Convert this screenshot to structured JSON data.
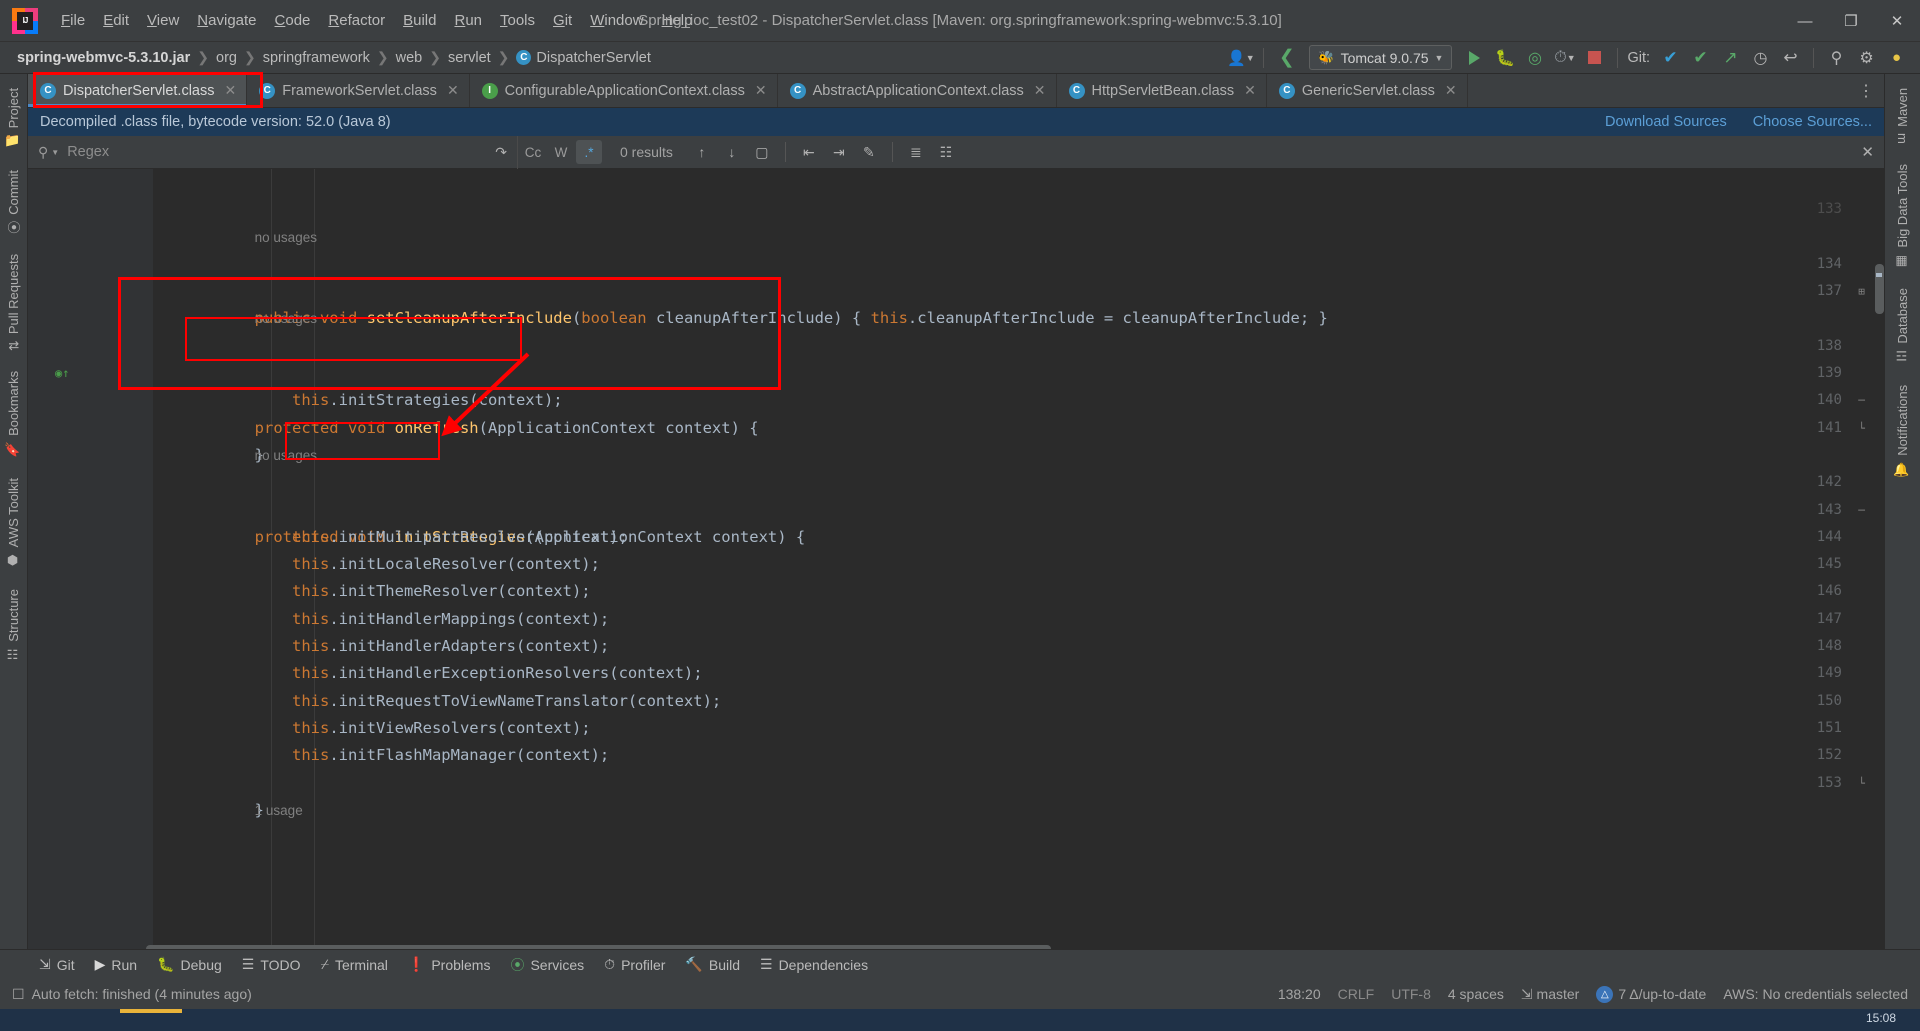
{
  "window": {
    "title": "Spring_ioc_test02 - DispatcherServlet.class [Maven: org.springframework:spring-webmvc:5.3.10]",
    "minimize": "—",
    "maximize": "❐",
    "close": "✕"
  },
  "menu": [
    {
      "label": "File"
    },
    {
      "label": "Edit"
    },
    {
      "label": "View"
    },
    {
      "label": "Navigate"
    },
    {
      "label": "Code"
    },
    {
      "label": "Refactor"
    },
    {
      "label": "Build"
    },
    {
      "label": "Run"
    },
    {
      "label": "Tools"
    },
    {
      "label": "Git"
    },
    {
      "label": "Window"
    },
    {
      "label": "Help"
    }
  ],
  "breadcrumb": [
    {
      "label": "spring-webmvc-5.3.10.jar",
      "icon": "none"
    },
    {
      "label": "org",
      "icon": "none"
    },
    {
      "label": "springframework",
      "icon": "none"
    },
    {
      "label": "web",
      "icon": "none"
    },
    {
      "label": "servlet",
      "icon": "none"
    },
    {
      "label": "DispatcherServlet",
      "icon": "class"
    }
  ],
  "toolbar": {
    "run_config": "Tomcat 9.0.75",
    "git_label": "Git:",
    "icons": {
      "user": "👤",
      "back_arrow": "‹",
      "run": "run-triangle",
      "debug": "🐞",
      "run_with_coverage": "coverage",
      "profiler": "profiler",
      "stop": "stop-square",
      "update_project": "✔",
      "commit": "✔",
      "push": "↗",
      "history": "◷",
      "rollback": "↩",
      "search_everywhere": "⌕",
      "settings": "⚙"
    }
  },
  "tabs": [
    {
      "label": "DispatcherServlet.class",
      "icon": "class",
      "active": true
    },
    {
      "label": "FrameworkServlet.class",
      "icon": "class",
      "active": false
    },
    {
      "label": "ConfigurableApplicationContext.class",
      "icon": "interface",
      "active": false
    },
    {
      "label": "AbstractApplicationContext.class",
      "icon": "class",
      "active": false
    },
    {
      "label": "HttpServletBean.class",
      "icon": "class",
      "active": false
    },
    {
      "label": "GenericServlet.class",
      "icon": "class",
      "active": false
    }
  ],
  "banner": {
    "text": "Decompiled .class file, bytecode version: 52.0 (Java 8)",
    "download_sources": "Download Sources",
    "choose_sources": "Choose Sources..."
  },
  "findbar": {
    "placeholder": "Regex",
    "value": "",
    "match_case": "Cc",
    "words": "W",
    "regex": ".*",
    "results": "0 results",
    "prev": "↑",
    "next": "↓",
    "select_all": "▢",
    "close": "✕"
  },
  "left_tool_strip": [
    {
      "label": "Project",
      "icon": "project-icon"
    },
    {
      "label": "Commit",
      "icon": "commit-icon"
    },
    {
      "label": "Pull Requests",
      "icon": "pull-requests-icon"
    },
    {
      "label": "Bookmarks",
      "icon": "bookmarks-icon"
    },
    {
      "label": "AWS Toolkit",
      "icon": "aws-icon"
    },
    {
      "label": "Structure",
      "icon": "structure-icon"
    }
  ],
  "right_tool_strip": [
    {
      "label": "Maven",
      "icon": "maven-icon"
    },
    {
      "label": "Big Data Tools",
      "icon": "bigdata-icon"
    },
    {
      "label": "Database",
      "icon": "database-icon"
    },
    {
      "label": "Notifications",
      "icon": "notifications-icon"
    }
  ],
  "code": {
    "lines": [
      {
        "no": "133",
        "usage": "",
        "text": "",
        "fold": ""
      },
      {
        "no": "",
        "usage": "no usages",
        "text": "",
        "fold": ""
      },
      {
        "no": "134",
        "usage": "",
        "text": "public void setCleanupAfterInclude(boolean cleanupAfterInclude) { this.cleanupAfterInclude = cleanupAfterInclude; }",
        "fold": "+"
      },
      {
        "no": "137",
        "usage": "",
        "text": "",
        "fold": ""
      },
      {
        "no": "",
        "usage": "no usages",
        "text": "",
        "fold": ""
      },
      {
        "no": "138",
        "usage": "",
        "text": "protected void onRefresh(ApplicationContext context) {",
        "fold": "─"
      },
      {
        "no": "139",
        "usage": "",
        "text": "    this.initStrategies(context);",
        "fold": ""
      },
      {
        "no": "140",
        "usage": "",
        "text": "}",
        "fold": "└"
      },
      {
        "no": "141",
        "usage": "",
        "text": "",
        "fold": ""
      },
      {
        "no": "",
        "usage": "no usages",
        "text": "",
        "fold": ""
      },
      {
        "no": "142",
        "usage": "",
        "text": "protected void initStrategies(ApplicationContext context) {",
        "fold": "─"
      },
      {
        "no": "143",
        "usage": "",
        "text": "    this.initMultipartResolver(context);",
        "fold": ""
      },
      {
        "no": "144",
        "usage": "",
        "text": "    this.initLocaleResolver(context);",
        "fold": ""
      },
      {
        "no": "145",
        "usage": "",
        "text": "    this.initThemeResolver(context);",
        "fold": ""
      },
      {
        "no": "146",
        "usage": "",
        "text": "    this.initHandlerMappings(context);",
        "fold": ""
      },
      {
        "no": "147",
        "usage": "",
        "text": "    this.initHandlerAdapters(context);",
        "fold": ""
      },
      {
        "no": "148",
        "usage": "",
        "text": "    this.initHandlerExceptionResolvers(context);",
        "fold": ""
      },
      {
        "no": "149",
        "usage": "",
        "text": "    this.initRequestToViewNameTranslator(context);",
        "fold": ""
      },
      {
        "no": "150",
        "usage": "",
        "text": "    this.initViewResolvers(context);",
        "fold": ""
      },
      {
        "no": "151",
        "usage": "",
        "text": "    this.initFlashMapManager(context);",
        "fold": ""
      },
      {
        "no": "152",
        "usage": "",
        "text": "}",
        "fold": "└"
      },
      {
        "no": "153",
        "usage": "",
        "text": "",
        "fold": ""
      },
      {
        "no": "",
        "usage": "1 usage",
        "text": "",
        "fold": ""
      }
    ]
  },
  "bottom_tools": [
    {
      "label": "Git",
      "icon": "git-branch-icon"
    },
    {
      "label": "Run",
      "icon": "run-icon"
    },
    {
      "label": "Debug",
      "icon": "debug-icon"
    },
    {
      "label": "TODO",
      "icon": "todo-icon"
    },
    {
      "label": "Terminal",
      "icon": "terminal-icon"
    },
    {
      "label": "Problems",
      "icon": "problems-icon"
    },
    {
      "label": "Services",
      "icon": "services-icon"
    },
    {
      "label": "Profiler",
      "icon": "profiler-icon"
    },
    {
      "label": "Build",
      "icon": "build-icon"
    },
    {
      "label": "Dependencies",
      "icon": "dependencies-icon"
    }
  ],
  "status": {
    "message": "Auto fetch: finished (4 minutes ago)",
    "caret": "138:20",
    "line_sep": "CRLF",
    "encoding": "UTF-8",
    "indent": "4 spaces",
    "branch": "master",
    "git_status": "7 Δ/up-to-date",
    "aws": "AWS: No credentials selected"
  },
  "taskbar": {
    "clock": "15:08"
  },
  "colors": {
    "accent_blue": "#4a88c7",
    "annotation_red": "#ff0000",
    "keyword": "#cc7832",
    "method": "#ffc66d",
    "text": "#a9b7c6",
    "background": "#2b2b2b"
  }
}
